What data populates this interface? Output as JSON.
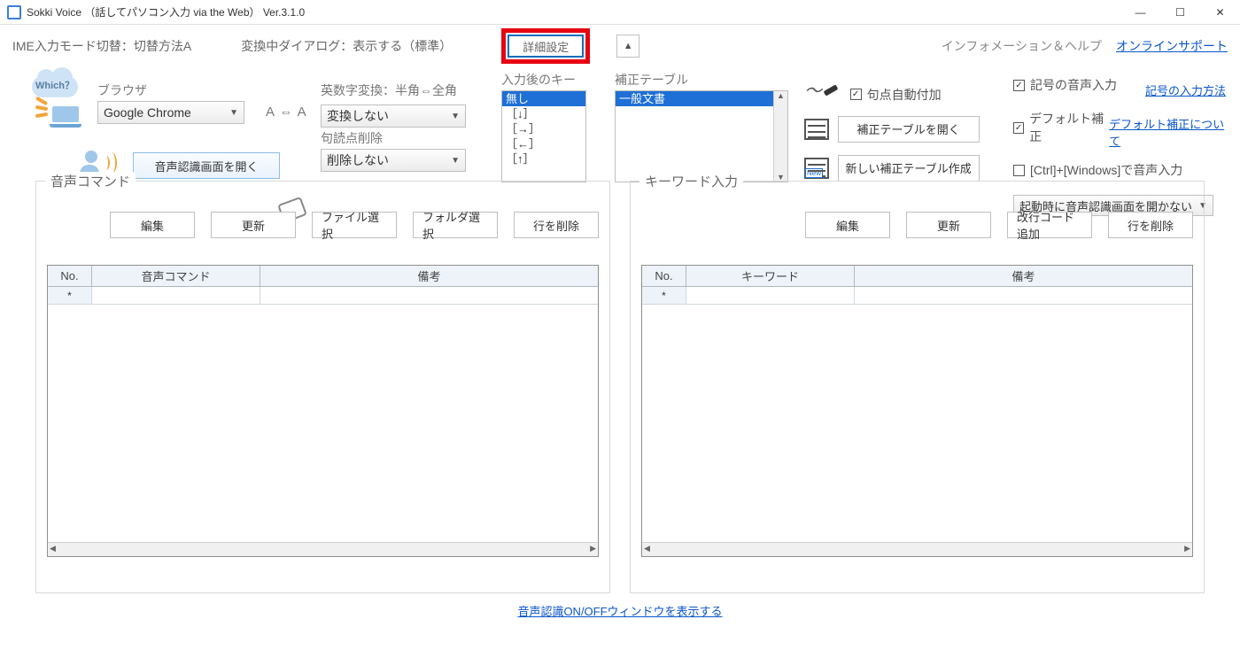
{
  "window": {
    "title": "Sokki Voice （話してパソコン入力 via the Web） Ver.3.1.0"
  },
  "top": {
    "ime_mode": "IME入力モード切替：切替方法A",
    "conv_dialog": "変換中ダイアログ：表示する（標準）",
    "detail_label": "詳細設定",
    "info_help": "インフォメーション＆ヘルプ",
    "online_support": "オンラインサポート"
  },
  "browser": {
    "which": "Which？",
    "label": "ブラウザ",
    "selected": "Google Chrome",
    "open_recog_label": "音声認識画面を開く"
  },
  "conversion": {
    "alnum_label": "英数字変換：半角⇔全角",
    "alnum_selected": "変換しない",
    "punct_label": "句読点削除",
    "punct_selected": "削除しない",
    "aa_icon": "A ⇔ A"
  },
  "key_after": {
    "label": "入力後のキー",
    "items": [
      "無し",
      "［↓］",
      "［→］",
      "［←］",
      "［↑］"
    ],
    "selected_index": 0
  },
  "correction": {
    "label": "補正テーブル",
    "items": [
      "一般文書"
    ],
    "selected_index": 0
  },
  "auto": {
    "punct_auto": "句点自動付加",
    "open_corr_table": "補正テーブルを開く",
    "new_corr_table": "新しい補正テーブル作成"
  },
  "right": {
    "symbol_voice": "記号の音声入力",
    "symbol_howto_link": "記号の入力方法",
    "default_corr": "デフォルト補正",
    "default_corr_link": "デフォルト補正について",
    "ctrl_win": "[Ctrl]+[Windows]で音声入力",
    "startup_combo": "起動時に音声認識画面を開かない"
  },
  "voice_cmd": {
    "legend": "音声コマンド",
    "buttons": {
      "edit": "編集",
      "refresh": "更新",
      "file_select": "ファイル選択",
      "folder_select": "フォルダ選択",
      "delete_row": "行を削除"
    },
    "headers": {
      "no": "No.",
      "a": "音声コマンド",
      "b": "備考"
    },
    "rows": [
      {
        "no": "*",
        "a": "",
        "b": ""
      }
    ]
  },
  "keyword": {
    "legend": "キーワード入力",
    "buttons": {
      "edit": "編集",
      "refresh": "更新",
      "newline": "改行コード追加",
      "delete_row": "行を削除"
    },
    "headers": {
      "no": "No.",
      "a": "キーワード",
      "b": "備考"
    },
    "rows": [
      {
        "no": "*",
        "a": "",
        "b": ""
      }
    ]
  },
  "bottom": {
    "link": "音声認識ON/OFFウィンドウを表示する"
  }
}
